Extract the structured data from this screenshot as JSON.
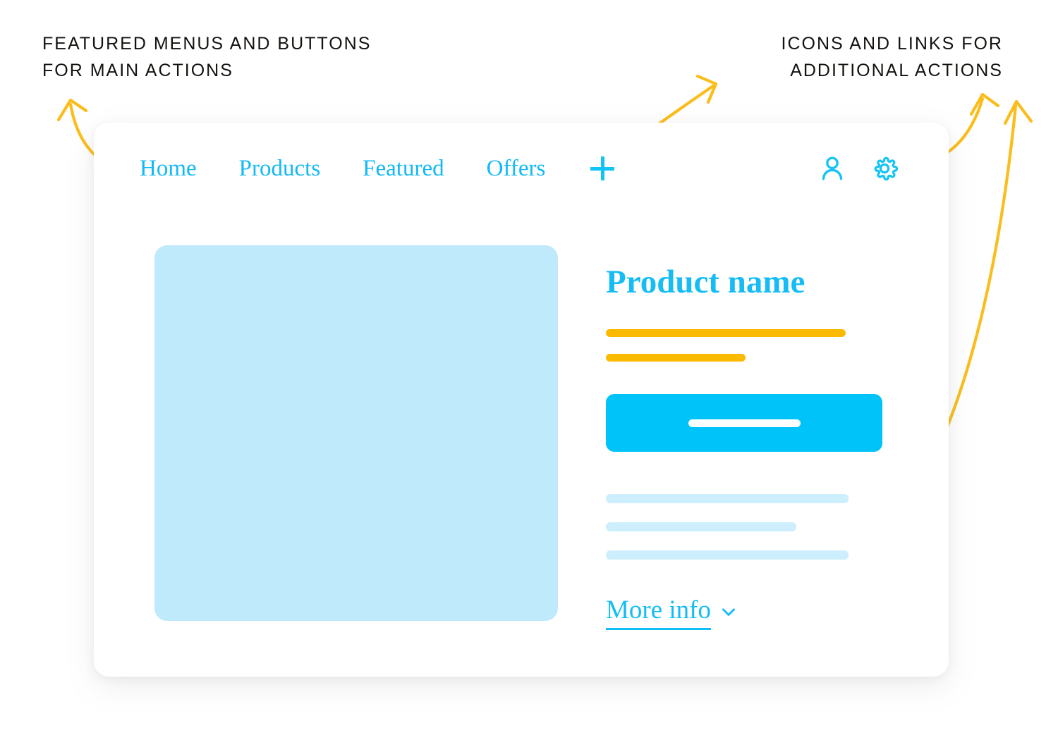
{
  "annotations": {
    "left": {
      "text": "FEATURED MENUS AND BUTTONS\nFOR MAIN ACTIONS",
      "color": "#14120f"
    },
    "right": {
      "text": "ICONS AND LINKS FOR\nADDITIONAL ACTIONS",
      "color": "#14120f"
    },
    "arrow_color": "#fbbd1b"
  },
  "colors": {
    "accent_cyan": "#00c3f9",
    "link_cyan": "#11b9f5",
    "amber": "#fbb900",
    "pale_blue": "#cdeefc",
    "image_blue": "#bfeafb",
    "card_white": "#ffffff",
    "page_background": "#ffffff",
    "annotation_text": "#14120f"
  },
  "card": {
    "nav": {
      "links": [
        {
          "label": "Home"
        },
        {
          "label": "Products"
        },
        {
          "label": "Featured"
        },
        {
          "label": "Offers"
        }
      ],
      "add_icon": "plus-icon",
      "right_icons": [
        {
          "name": "user-account-icon"
        },
        {
          "name": "settings-gear-icon"
        }
      ]
    },
    "main": {
      "image_placeholder": "product-image-placeholder",
      "detail": {
        "title": "Product name",
        "amber_bars": [
          {
            "name": "price-bar"
          },
          {
            "name": "subtitle-bar"
          }
        ],
        "cta_button": {
          "name": "add-to-cart-button",
          "label": ""
        },
        "description_bars": [
          {
            "name": "description-line-1"
          },
          {
            "name": "description-line-2"
          },
          {
            "name": "description-line-3"
          }
        ],
        "more_info": {
          "label": "More info",
          "icon": "chevron-down-icon"
        }
      }
    }
  }
}
